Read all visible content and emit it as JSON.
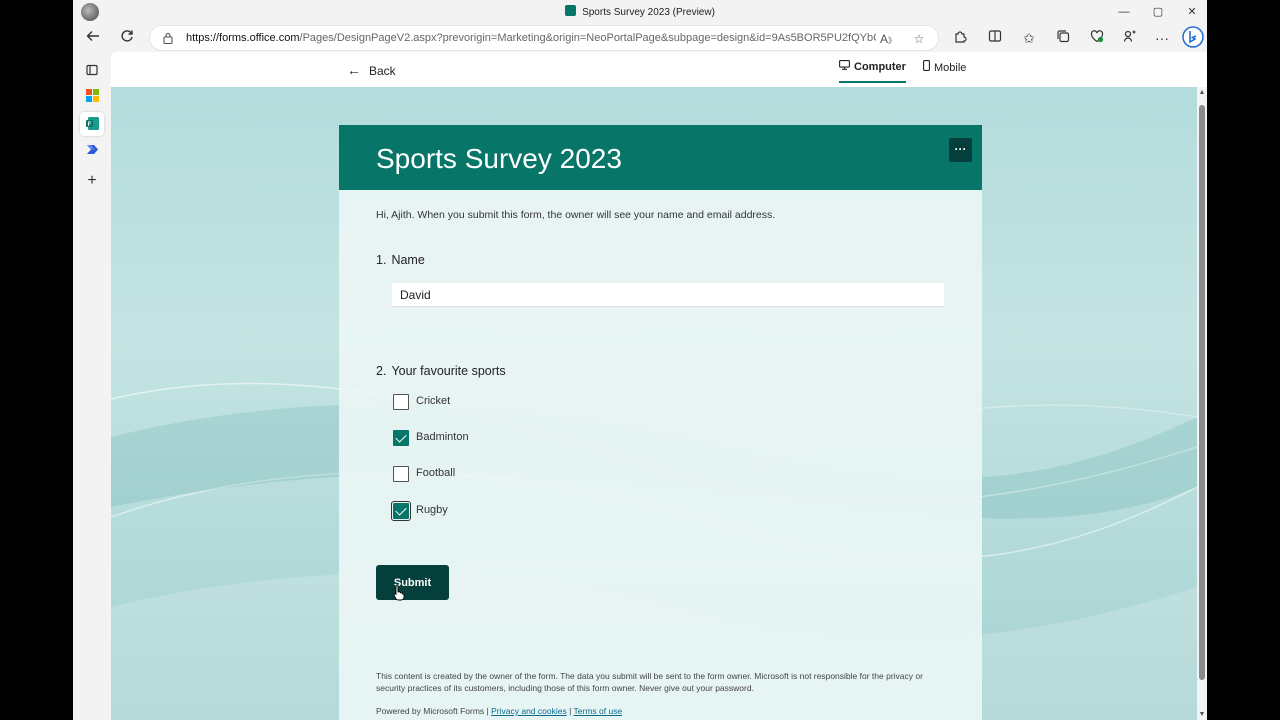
{
  "browser": {
    "window_title": "Sports Survey 2023 (Preview)",
    "url_host": "https://forms.office.com",
    "url_rest": "/Pages/DesignPageV2.aspx?prevorigin=Marketing&origin=NeoPortalPage&subpage=design&id=9As5BOR5PU2fQYbCO...",
    "controls": {
      "minimize": "—",
      "maximize": "▢",
      "close": "✕"
    },
    "icons": [
      "back-icon",
      "refresh-icon",
      "lock-icon",
      "read-aloud-icon",
      "favorite-icon",
      "extensions-icon",
      "split-screen-icon",
      "favorites-icon",
      "collections-icon",
      "browser-essentials-icon",
      "copilot-icon",
      "more-icon",
      "bing-icon"
    ]
  },
  "sidebar": {
    "items": [
      "tab-actions-icon",
      "office-icon",
      "forms-icon",
      "power-automate-icon",
      "add-icon"
    ]
  },
  "topbar": {
    "back_label": "Back",
    "view_computer": "Computer",
    "view_mobile": "Mobile",
    "active_view": "Computer"
  },
  "form": {
    "title": "Sports Survey 2023",
    "more_label": "···",
    "intro": "Hi, Ajith. When you submit this form, the owner will see your name and email address.",
    "q1": {
      "number": "1.",
      "label": "Name",
      "value": "David"
    },
    "q2": {
      "number": "2.",
      "label": "Your favourite sports",
      "options": [
        {
          "label": "Cricket",
          "checked": false
        },
        {
          "label": "Badminton",
          "checked": true
        },
        {
          "label": "Football",
          "checked": false
        },
        {
          "label": "Rugby",
          "checked": true
        }
      ]
    },
    "submit_label": "Submit",
    "disclaimer": "This content is created by the owner of the form. The data you submit will be sent to the form owner. Microsoft is not responsible for the privacy or security practices of its customers, including those of this form owner. Never give out your password.",
    "powered_by": "Powered by Microsoft Forms |",
    "privacy_link": "Privacy and cookies",
    "separator": "|",
    "terms_link": "Terms of use"
  },
  "colors": {
    "accent": "#077568",
    "accent_dark": "#053f3b"
  }
}
